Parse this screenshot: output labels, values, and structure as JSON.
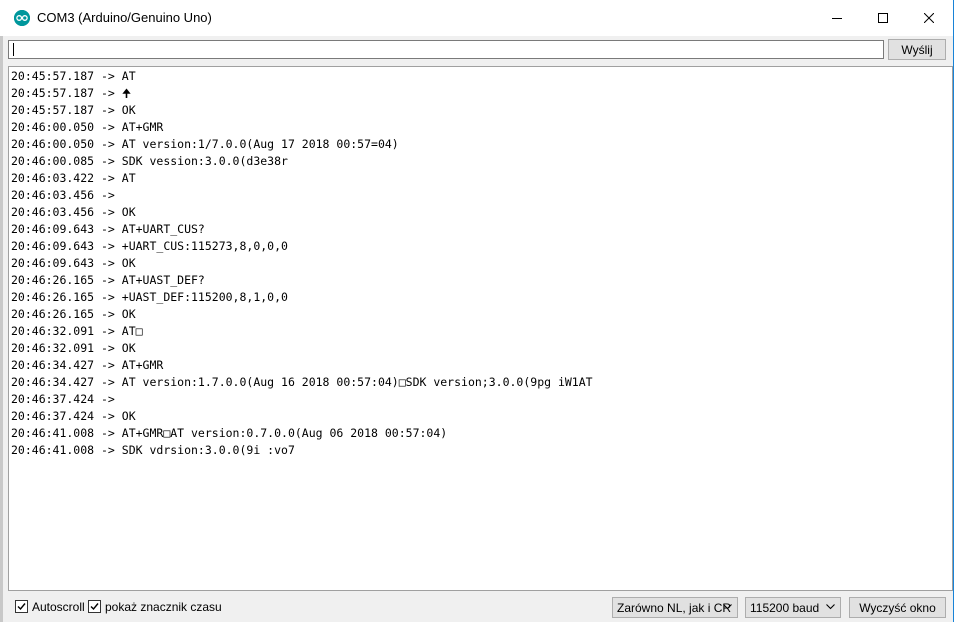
{
  "window": {
    "title": "COM3 (Arduino/Genuino Uno)",
    "minimize_icon": "minimize-icon",
    "maximize_icon": "maximize-icon",
    "close_icon": "close-icon"
  },
  "input": {
    "value": "",
    "send_label": "Wyślij"
  },
  "log": [
    "20:45:57.187 -> AT",
    "20:45:57.187 -> 🠉",
    "20:45:57.187 -> OK",
    "20:46:00.050 -> AT+GMR",
    "20:46:00.050 -> AT version:1/7.0.0(Aug 17 2018 00:57=04)",
    "20:46:00.085 -> SDK vession:3.0.0(d3e38r",
    "20:46:03.422 -> AT",
    "20:46:03.456 -> ",
    "20:46:03.456 -> OK",
    "20:46:09.643 -> AT+UART_CUS?",
    "20:46:09.643 -> +UART_CUS:115273,8,0,0,0",
    "20:46:09.643 -> OK",
    "20:46:26.165 -> AT+UAST_DEF?",
    "20:46:26.165 -> +UAST_DEF:115200,8,1,0,0",
    "20:46:26.165 -> OK",
    "20:46:32.091 -> AT□",
    "20:46:32.091 -> OK",
    "20:46:34.427 -> AT+GMR",
    "20:46:34.427 -> AT version:1.7.0.0(Aug 16 2018 00:57:04)□SDK version;3.0.0(9pg iW1AT",
    "20:46:37.424 -> ",
    "20:46:37.424 -> OK",
    "20:46:41.008 -> AT+GMR□AT version:0.7.0.0(Aug 06 2018 00:57:04)",
    "20:46:41.008 -> SDK vdrsion:3.0.0(9i :vo7"
  ],
  "bottom": {
    "autoscroll_label": "Autoscroll",
    "autoscroll_checked": true,
    "timestamp_label": "pokaż znacznik czasu",
    "timestamp_checked": true,
    "line_ending": "Zarówno NL, jak i CR",
    "baud": "115200 baud",
    "clear_label": "Wyczyść okno"
  },
  "colors": {
    "accent_border": "#1883d7",
    "app_icon": "#00979c"
  }
}
